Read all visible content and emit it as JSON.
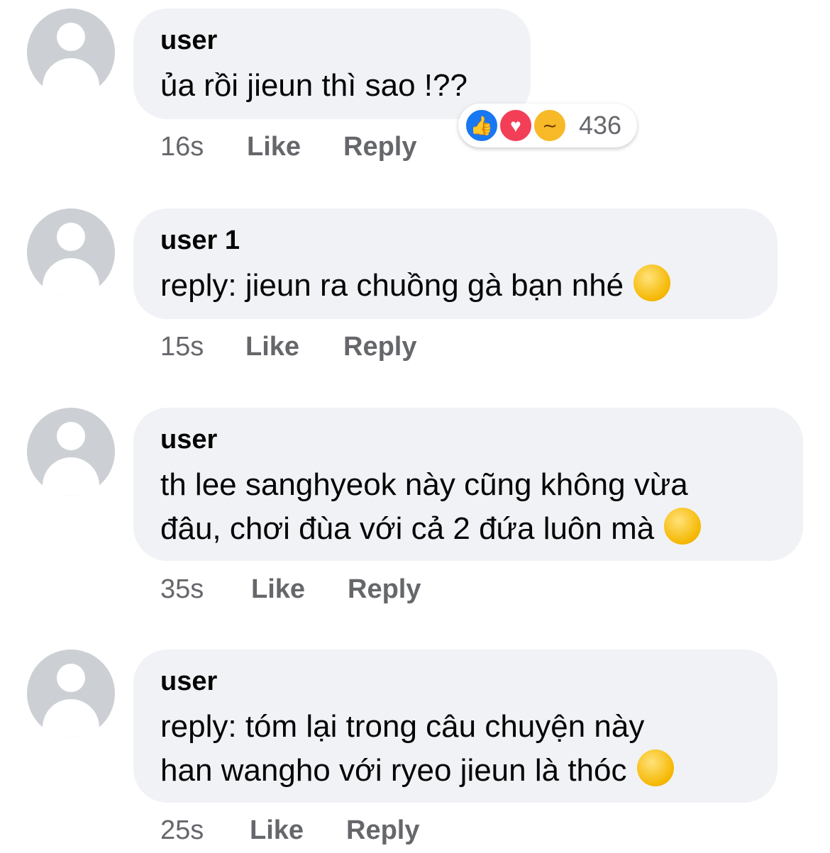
{
  "comments": [
    {
      "name": "user",
      "lines": [
        "ủa rồi jieun thì sao !??"
      ],
      "time": "16s",
      "like_label": "Like",
      "reply_label": "Reply",
      "reactions": {
        "count": "436",
        "icons": [
          "like-icon",
          "love-icon",
          "haha-icon"
        ]
      }
    },
    {
      "name": "user 1",
      "lines": [
        "reply: jieun ra chuồng gà bạn nhé"
      ],
      "emoji": "ok-hand-emoji",
      "time": "15s",
      "like_label": "Like",
      "reply_label": "Reply"
    },
    {
      "name": "user",
      "lines": [
        "th lee sanghyeok này cũng không vừa",
        "đâu, chơi đùa với cả 2 đứa luôn mà"
      ],
      "emoji": "grinning-face-emoji",
      "time": "35s",
      "like_label": "Like",
      "reply_label": "Reply"
    },
    {
      "name": "user",
      "lines": [
        "reply: tóm lại trong câu chuyện này",
        "han wangho với ryeo jieun là thóc"
      ],
      "emoji": "relieved-face-emoji",
      "time": "25s",
      "like_label": "Like",
      "reply_label": "Reply"
    }
  ],
  "colors": {
    "bubble": "#f0f2f5",
    "like": "#1877f2",
    "love": "#f33e58",
    "haha": "#f7b928",
    "meta": "#65676b"
  }
}
